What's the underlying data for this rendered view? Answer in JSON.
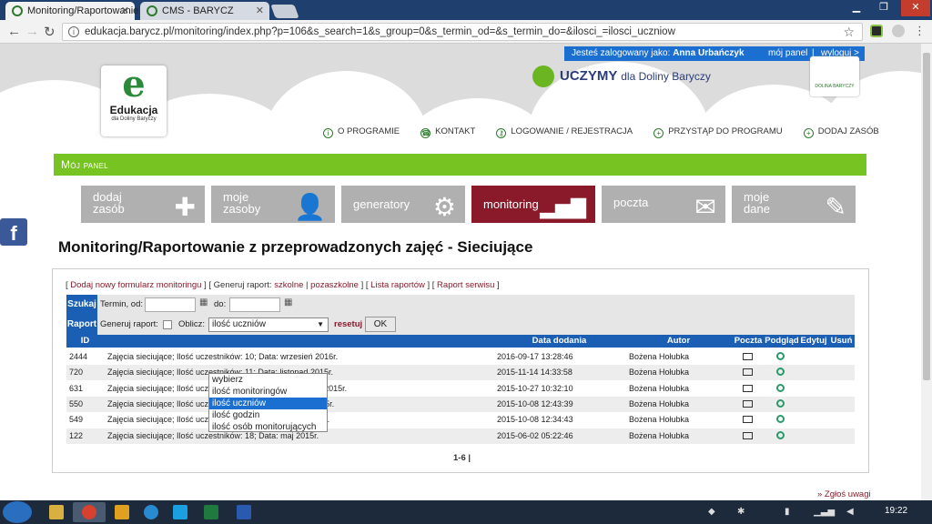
{
  "browser": {
    "tabs": [
      {
        "label": "Monitoring/Raportowanie",
        "active": true
      },
      {
        "label": "CMS - BARYCZ",
        "active": false
      }
    ],
    "url": "edukacja.barycz.pl/monitoring/index.php?p=106&s_search=1&s_group=0&s_termin_od=&s_termin_do=&ilosci_=ilosci_uczniow"
  },
  "header": {
    "login_text": "Jesteś zalogowany jako:",
    "user": "Anna Urbańczyk",
    "my_panel": "mój panel",
    "logout": "wyloguj >",
    "logo_letter": "e",
    "logo_name": "Edukacja",
    "logo_sub": "dla Doliny Baryczy",
    "uczymy": "UCZYMY",
    "uczymy_sub": "dla Doliny Baryczy",
    "barycz_logo": "DOLINA BARYCZY"
  },
  "topnav": [
    "O PROGRAMIE",
    "KONTAKT",
    "LOGOWANIE / REJESTRACJA",
    "PRZYSTĄP DO PROGRAMU",
    "DODAJ ZASÓB"
  ],
  "panel_title": "Mój panel",
  "tiles": [
    {
      "line1": "dodaj",
      "line2": "zasób",
      "icon": "plus-icon"
    },
    {
      "line1": "moje",
      "line2": "zasoby",
      "icon": "person-icon"
    },
    {
      "line1": "generatory",
      "line2": "",
      "icon": "gear-icon"
    },
    {
      "line1": "monitoring",
      "line2": "",
      "icon": "bar-chart-icon"
    },
    {
      "line1": "poczta",
      "line2": "",
      "icon": "envelope-icon"
    },
    {
      "line1": "moje",
      "line2": "dane",
      "icon": "edit-icon"
    }
  ],
  "facebook": "f",
  "page_title": "Monitoring/Raportowanie z przeprowadzonych zajęć - Sieciujące",
  "links": {
    "add_form": "Dodaj nowy formularz monitoringu",
    "report_label": "Generuj raport:",
    "report_school": "szkolne",
    "report_out": "pozaszkolne",
    "report_list": "Lista raportów",
    "report_service": "Raport serwisu"
  },
  "search": {
    "label": "Szukaj",
    "from_label": "Termin, od:",
    "to_label": "do:",
    "from_value": "",
    "to_value": ""
  },
  "report": {
    "label": "Raport",
    "generate_label": "Generuj raport:",
    "calc_label": "Oblicz:",
    "selected": "ilość uczniów",
    "reset": "resetuj",
    "ok": "OK",
    "options": [
      "wybierz",
      "ilość monitoringów",
      "ilość uczniów",
      "ilość godzin",
      "ilość osób monitorujących"
    ]
  },
  "table": {
    "headers": [
      "ID",
      "",
      "Data dodania",
      "Autor",
      "Poczta",
      "Podgląd",
      "Edytuj",
      "Usuń"
    ],
    "rows": [
      {
        "id": "2444",
        "title": "Zajęcia sieciujące; Ilość uczestników: 10; Data: wrzesień 2016r.",
        "date": "2016-09-17 13:28:46",
        "author": "Bożena Hołubka"
      },
      {
        "id": "720",
        "title": "Zajęcia sieciujące; Ilość uczestników: 11; Data: listopad 2015r.",
        "date": "2015-11-14 14:33:58",
        "author": "Bożena Hołubka"
      },
      {
        "id": "631",
        "title": "Zajęcia sieciujące; Ilość uczestników: 10; Data: październik 2015r.",
        "date": "2015-10-27 10:32:10",
        "author": "Bożena Hołubka"
      },
      {
        "id": "550",
        "title": "Zajęcia sieciujące; Ilość uczestników: 10; Data: sierpień 2015r.",
        "date": "2015-10-08 12:43:39",
        "author": "Bożena Hołubka"
      },
      {
        "id": "549",
        "title": "Zajęcia sieciujące; Ilość uczestników: 8; Data: sierpień 2015r.",
        "date": "2015-10-08 12:34:43",
        "author": "Bożena Hołubka"
      },
      {
        "id": "122",
        "title": "Zajęcia sieciujące; Ilość uczestników: 18; Data: maj 2015r.",
        "date": "2015-06-02 05:22:46",
        "author": "Bożena Hołubka"
      }
    ]
  },
  "pager": "1-6 |",
  "report_issue": "» Zgłoś uwagi",
  "taskbar": {
    "clock": "19:22"
  }
}
